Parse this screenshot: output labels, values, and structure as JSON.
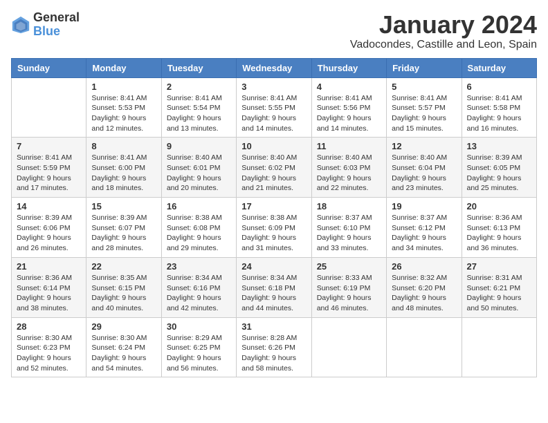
{
  "header": {
    "logo_line1": "General",
    "logo_line2": "Blue",
    "title": "January 2024",
    "subtitle": "Vadocondes, Castille and Leon, Spain"
  },
  "weekdays": [
    "Sunday",
    "Monday",
    "Tuesday",
    "Wednesday",
    "Thursday",
    "Friday",
    "Saturday"
  ],
  "weeks": [
    [
      {
        "day": "",
        "sunrise": "",
        "sunset": "",
        "daylight": ""
      },
      {
        "day": "1",
        "sunrise": "Sunrise: 8:41 AM",
        "sunset": "Sunset: 5:53 PM",
        "daylight": "Daylight: 9 hours and 12 minutes."
      },
      {
        "day": "2",
        "sunrise": "Sunrise: 8:41 AM",
        "sunset": "Sunset: 5:54 PM",
        "daylight": "Daylight: 9 hours and 13 minutes."
      },
      {
        "day": "3",
        "sunrise": "Sunrise: 8:41 AM",
        "sunset": "Sunset: 5:55 PM",
        "daylight": "Daylight: 9 hours and 14 minutes."
      },
      {
        "day": "4",
        "sunrise": "Sunrise: 8:41 AM",
        "sunset": "Sunset: 5:56 PM",
        "daylight": "Daylight: 9 hours and 14 minutes."
      },
      {
        "day": "5",
        "sunrise": "Sunrise: 8:41 AM",
        "sunset": "Sunset: 5:57 PM",
        "daylight": "Daylight: 9 hours and 15 minutes."
      },
      {
        "day": "6",
        "sunrise": "Sunrise: 8:41 AM",
        "sunset": "Sunset: 5:58 PM",
        "daylight": "Daylight: 9 hours and 16 minutes."
      }
    ],
    [
      {
        "day": "7",
        "sunrise": "Sunrise: 8:41 AM",
        "sunset": "Sunset: 5:59 PM",
        "daylight": "Daylight: 9 hours and 17 minutes."
      },
      {
        "day": "8",
        "sunrise": "Sunrise: 8:41 AM",
        "sunset": "Sunset: 6:00 PM",
        "daylight": "Daylight: 9 hours and 18 minutes."
      },
      {
        "day": "9",
        "sunrise": "Sunrise: 8:40 AM",
        "sunset": "Sunset: 6:01 PM",
        "daylight": "Daylight: 9 hours and 20 minutes."
      },
      {
        "day": "10",
        "sunrise": "Sunrise: 8:40 AM",
        "sunset": "Sunset: 6:02 PM",
        "daylight": "Daylight: 9 hours and 21 minutes."
      },
      {
        "day": "11",
        "sunrise": "Sunrise: 8:40 AM",
        "sunset": "Sunset: 6:03 PM",
        "daylight": "Daylight: 9 hours and 22 minutes."
      },
      {
        "day": "12",
        "sunrise": "Sunrise: 8:40 AM",
        "sunset": "Sunset: 6:04 PM",
        "daylight": "Daylight: 9 hours and 23 minutes."
      },
      {
        "day": "13",
        "sunrise": "Sunrise: 8:39 AM",
        "sunset": "Sunset: 6:05 PM",
        "daylight": "Daylight: 9 hours and 25 minutes."
      }
    ],
    [
      {
        "day": "14",
        "sunrise": "Sunrise: 8:39 AM",
        "sunset": "Sunset: 6:06 PM",
        "daylight": "Daylight: 9 hours and 26 minutes."
      },
      {
        "day": "15",
        "sunrise": "Sunrise: 8:39 AM",
        "sunset": "Sunset: 6:07 PM",
        "daylight": "Daylight: 9 hours and 28 minutes."
      },
      {
        "day": "16",
        "sunrise": "Sunrise: 8:38 AM",
        "sunset": "Sunset: 6:08 PM",
        "daylight": "Daylight: 9 hours and 29 minutes."
      },
      {
        "day": "17",
        "sunrise": "Sunrise: 8:38 AM",
        "sunset": "Sunset: 6:09 PM",
        "daylight": "Daylight: 9 hours and 31 minutes."
      },
      {
        "day": "18",
        "sunrise": "Sunrise: 8:37 AM",
        "sunset": "Sunset: 6:10 PM",
        "daylight": "Daylight: 9 hours and 33 minutes."
      },
      {
        "day": "19",
        "sunrise": "Sunrise: 8:37 AM",
        "sunset": "Sunset: 6:12 PM",
        "daylight": "Daylight: 9 hours and 34 minutes."
      },
      {
        "day": "20",
        "sunrise": "Sunrise: 8:36 AM",
        "sunset": "Sunset: 6:13 PM",
        "daylight": "Daylight: 9 hours and 36 minutes."
      }
    ],
    [
      {
        "day": "21",
        "sunrise": "Sunrise: 8:36 AM",
        "sunset": "Sunset: 6:14 PM",
        "daylight": "Daylight: 9 hours and 38 minutes."
      },
      {
        "day": "22",
        "sunrise": "Sunrise: 8:35 AM",
        "sunset": "Sunset: 6:15 PM",
        "daylight": "Daylight: 9 hours and 40 minutes."
      },
      {
        "day": "23",
        "sunrise": "Sunrise: 8:34 AM",
        "sunset": "Sunset: 6:16 PM",
        "daylight": "Daylight: 9 hours and 42 minutes."
      },
      {
        "day": "24",
        "sunrise": "Sunrise: 8:34 AM",
        "sunset": "Sunset: 6:18 PM",
        "daylight": "Daylight: 9 hours and 44 minutes."
      },
      {
        "day": "25",
        "sunrise": "Sunrise: 8:33 AM",
        "sunset": "Sunset: 6:19 PM",
        "daylight": "Daylight: 9 hours and 46 minutes."
      },
      {
        "day": "26",
        "sunrise": "Sunrise: 8:32 AM",
        "sunset": "Sunset: 6:20 PM",
        "daylight": "Daylight: 9 hours and 48 minutes."
      },
      {
        "day": "27",
        "sunrise": "Sunrise: 8:31 AM",
        "sunset": "Sunset: 6:21 PM",
        "daylight": "Daylight: 9 hours and 50 minutes."
      }
    ],
    [
      {
        "day": "28",
        "sunrise": "Sunrise: 8:30 AM",
        "sunset": "Sunset: 6:23 PM",
        "daylight": "Daylight: 9 hours and 52 minutes."
      },
      {
        "day": "29",
        "sunrise": "Sunrise: 8:30 AM",
        "sunset": "Sunset: 6:24 PM",
        "daylight": "Daylight: 9 hours and 54 minutes."
      },
      {
        "day": "30",
        "sunrise": "Sunrise: 8:29 AM",
        "sunset": "Sunset: 6:25 PM",
        "daylight": "Daylight: 9 hours and 56 minutes."
      },
      {
        "day": "31",
        "sunrise": "Sunrise: 8:28 AM",
        "sunset": "Sunset: 6:26 PM",
        "daylight": "Daylight: 9 hours and 58 minutes."
      },
      {
        "day": "",
        "sunrise": "",
        "sunset": "",
        "daylight": ""
      },
      {
        "day": "",
        "sunrise": "",
        "sunset": "",
        "daylight": ""
      },
      {
        "day": "",
        "sunrise": "",
        "sunset": "",
        "daylight": ""
      }
    ]
  ]
}
